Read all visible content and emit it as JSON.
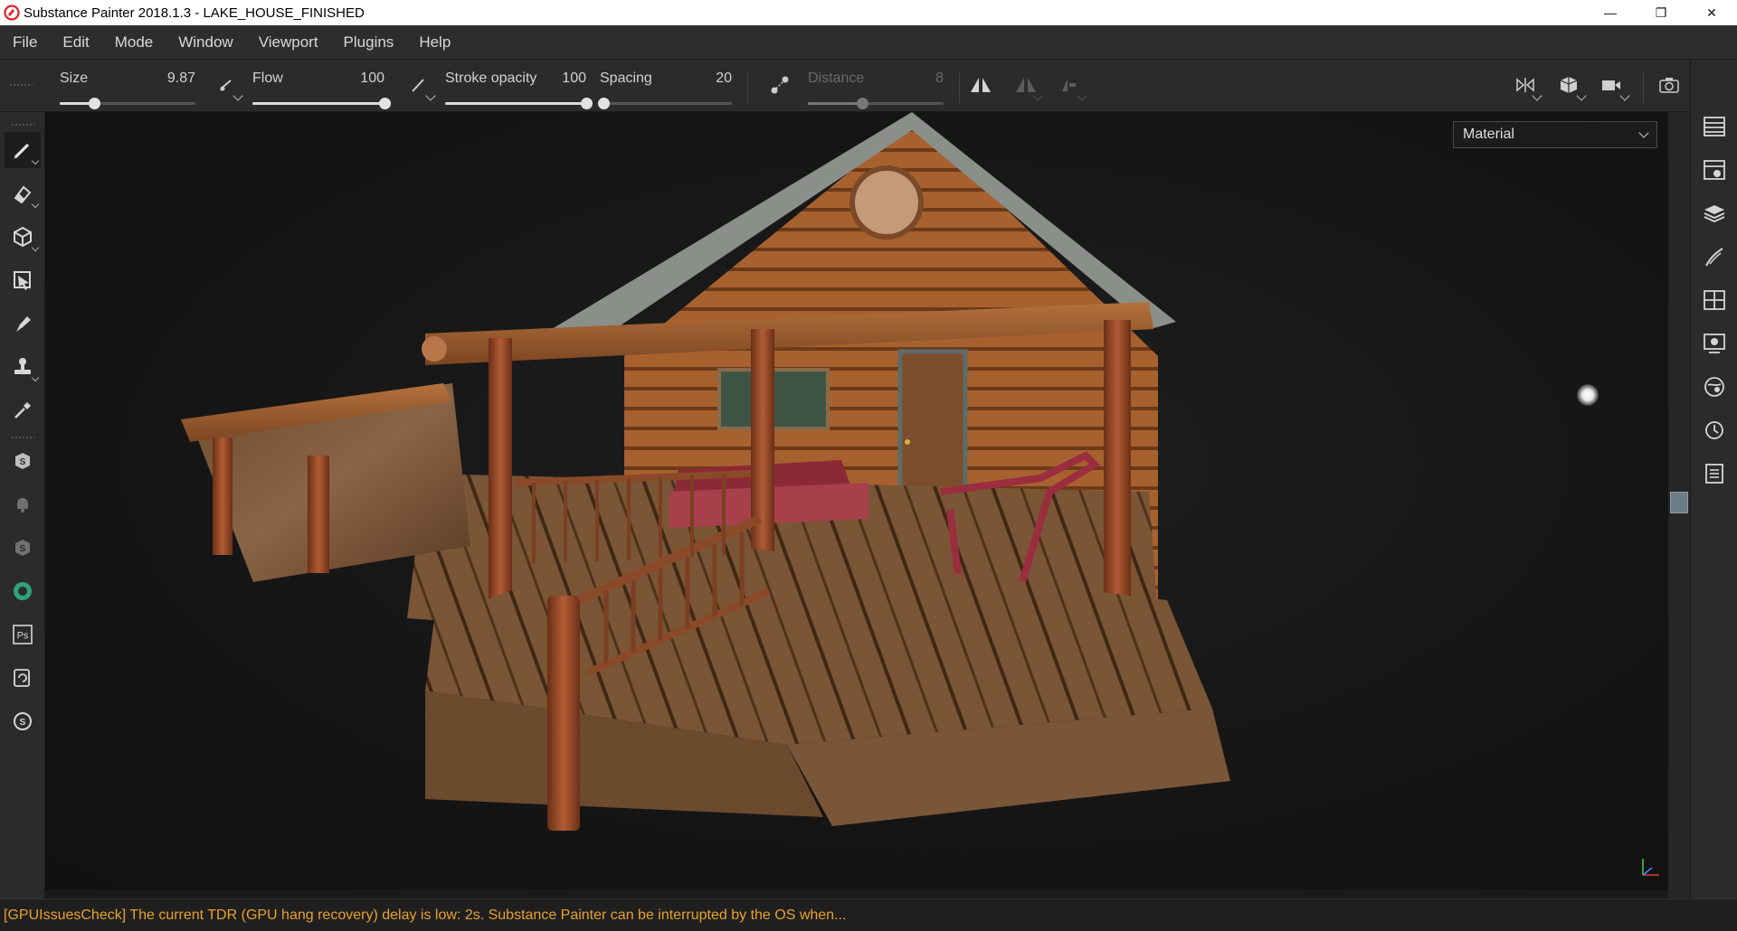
{
  "window": {
    "title": "Substance Painter 2018.1.3 - LAKE_HOUSE_FINISHED",
    "minimize": "—",
    "restore": "❐",
    "close": "✕"
  },
  "menu": [
    "File",
    "Edit",
    "Mode",
    "Window",
    "Viewport",
    "Plugins",
    "Help"
  ],
  "toolbar": {
    "size": {
      "label": "Size",
      "value": "9.87",
      "level": 0.25
    },
    "flow": {
      "label": "Flow",
      "value": "100",
      "level": 1.0
    },
    "stroke_opacity": {
      "label": "Stroke opacity",
      "value": "100",
      "level": 1.0
    },
    "spacing": {
      "label": "Spacing",
      "value": "20",
      "level": 0.03
    },
    "distance": {
      "label": "Distance",
      "value": "8",
      "level": 0.4,
      "disabled": true
    }
  },
  "left_tools": [
    {
      "name": "paint-brush-icon",
      "active": true
    },
    {
      "name": "eraser-icon"
    },
    {
      "name": "projection-icon"
    },
    {
      "name": "polygon-fill-icon"
    },
    {
      "name": "smudge-icon"
    },
    {
      "name": "clone-stamp-icon"
    },
    {
      "name": "color-picker-icon"
    },
    {
      "name": "substance-share-icon"
    },
    {
      "name": "notification-icon"
    },
    {
      "name": "substance-source-icon"
    },
    {
      "name": "alchemist-icon"
    },
    {
      "name": "photoshop-icon",
      "text": "Ps"
    },
    {
      "name": "sync-icon"
    },
    {
      "name": "substance-icon"
    }
  ],
  "viewport": {
    "display_mode": "Material"
  },
  "right_panel_icons": [
    "texture-set-list-icon",
    "texture-set-settings-icon",
    "layers-icon",
    "properties-icon",
    "uv-display-icon",
    "display-settings-icon",
    "shader-settings-icon",
    "history-icon",
    "log-icon"
  ],
  "status": {
    "message": "[GPUIssuesCheck] The current TDR (GPU hang recovery) delay is low: 2s. Substance Painter can be interrupted by the OS when..."
  },
  "colors": {
    "accent_status": "#e8a22c",
    "panel_bg": "#2b2b2b",
    "viewport_bg": "#151515"
  }
}
